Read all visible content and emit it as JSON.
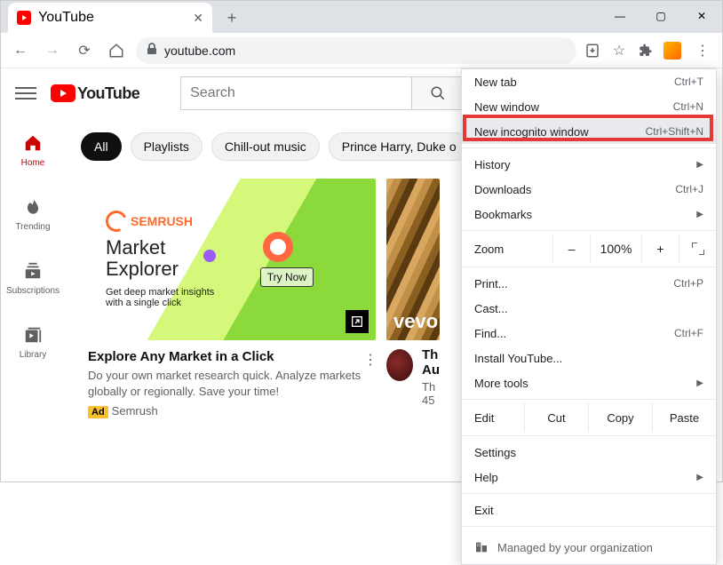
{
  "browser": {
    "tab_title": "YouTube",
    "url": "youtube.com"
  },
  "chrome_menu": {
    "new_tab": "New tab",
    "new_tab_sc": "Ctrl+T",
    "new_window": "New window",
    "new_window_sc": "Ctrl+N",
    "incognito": "New incognito window",
    "incognito_sc": "Ctrl+Shift+N",
    "history": "History",
    "downloads": "Downloads",
    "downloads_sc": "Ctrl+J",
    "bookmarks": "Bookmarks",
    "zoom": "Zoom",
    "zoom_minus": "–",
    "zoom_level": "100%",
    "zoom_plus": "+",
    "print": "Print...",
    "print_sc": "Ctrl+P",
    "cast": "Cast...",
    "find": "Find...",
    "find_sc": "Ctrl+F",
    "install": "Install YouTube...",
    "more_tools": "More tools",
    "edit": "Edit",
    "cut": "Cut",
    "copy": "Copy",
    "paste": "Paste",
    "settings": "Settings",
    "help": "Help",
    "exit": "Exit",
    "managed": "Managed by your organization"
  },
  "yt": {
    "logo_text": "YouTube",
    "search_placeholder": "Search",
    "sidebar": {
      "home": "Home",
      "trending": "Trending",
      "subscriptions": "Subscriptions",
      "library": "Library"
    },
    "chips": {
      "all": "All",
      "playlists": "Playlists",
      "chillout": "Chill-out music",
      "harry": "Prince Harry, Duke o"
    },
    "ad": {
      "brand": "SEMRUSH",
      "headline1": "Market",
      "headline2": "Explorer",
      "sub1": "Get deep market insights",
      "sub2": "with a single click",
      "cta": "Try Now",
      "card_title": "Explore Any Market in a Click",
      "card_desc": "Do your own market research quick. Analyze markets globally or regionally. Save your time!",
      "ad_label": "Ad",
      "sponsor": "Semrush"
    },
    "video2": {
      "vevo": "vevo",
      "title_line1": "Th",
      "title_line2": "Au",
      "meta1": "Th",
      "meta2": "45"
    }
  }
}
